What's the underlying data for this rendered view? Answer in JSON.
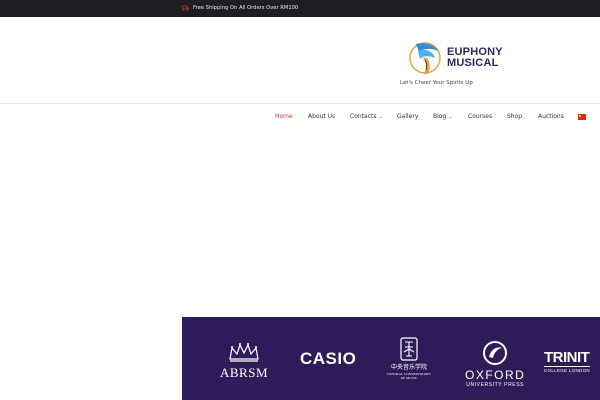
{
  "topbar": {
    "text": "Free Shipping On All Orders Over RM100",
    "icon": "shipping-icon",
    "icon_color": "#c0392b"
  },
  "brand": {
    "line1": "EUPHONY",
    "line2": "MUSICAL",
    "tagline": "Let's Cheer Your Spirits Up",
    "text_color": "#2a2a5e"
  },
  "nav": {
    "active_color": "#c0392b",
    "items": [
      {
        "label": "Home",
        "active": true
      },
      {
        "label": "About Us"
      },
      {
        "label": "Contacts",
        "has_dropdown": true
      },
      {
        "label": "Gallery"
      },
      {
        "label": "Blog",
        "has_dropdown": true
      },
      {
        "label": "Courses"
      },
      {
        "label": "Shop"
      },
      {
        "label": "Auctions"
      }
    ],
    "language_icon": "china-flag-icon"
  },
  "partners": {
    "background": "#2e1b5a",
    "abrsm": "ABRSM",
    "casio": "CASIO",
    "ccm_chinese": "中央音乐学院",
    "ccm_english_line1": "CENTRAL CONSERVATORY",
    "ccm_english_line2": "OF MUSIC",
    "oxford_name": "OXFORD",
    "oxford_sub": "UNIVERSITY PRESS",
    "trinity_name": "TRINIT",
    "trinity_sub": "COLLEGE LONDON"
  }
}
